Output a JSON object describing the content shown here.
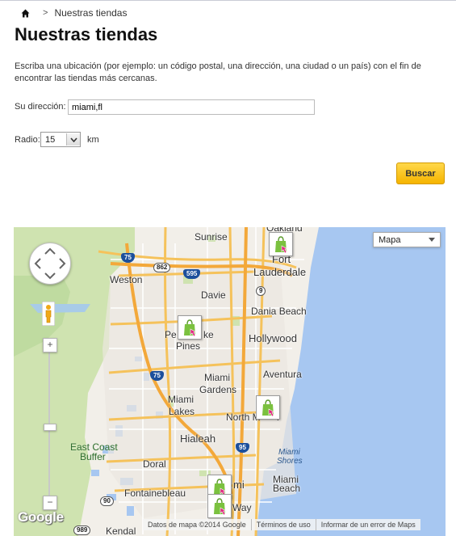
{
  "breadcrumb": {
    "separator": ">",
    "current": "Nuestras tiendas"
  },
  "page": {
    "title": "Nuestras tiendas",
    "intro": "Escriba una ubicación (por ejemplo: un código postal, una dirección, una ciudad o un país) con el fin de encontrar las tiendas más cercanas."
  },
  "form": {
    "address_label": "Su dirección:",
    "address_value": "miami,fl",
    "radius_label": "Radio:",
    "radius_value": "15",
    "radius_unit": "km",
    "search_button": "Buscar"
  },
  "map": {
    "type_selector": "Mapa",
    "zoom_in": "+",
    "zoom_out": "−",
    "logo": "Google",
    "footer": {
      "data": "Datos de mapa ©2014 Google",
      "terms": "Términos de uso",
      "report": "Informar de un error de Maps"
    },
    "places": {
      "oakland": "Oakland",
      "sunrise": "Sunrise",
      "fort": "Fort",
      "lauderdale": "Lauderdale",
      "weston": "Weston",
      "davie": "Davie",
      "dania_beach": "Dania Beach",
      "pembroke_a": "Pe",
      "pembroke_b": "ke",
      "pines": "Pines",
      "hollywood": "Hollywood",
      "aventura": "Aventura",
      "miami_gardens_a": "Miami",
      "miami_gardens_b": "Gardens",
      "miami_lakes_a": "Miami",
      "miami_lakes_b": "Lakes",
      "north_miami_a": "North M",
      "north_miami_b": "i",
      "east_coast_a": "East Coast",
      "east_coast_b": "Buffer",
      "hialeah": "Hialeah",
      "doral": "Doral",
      "miami_a": "Mi",
      "miami_b": "mi",
      "miami_beach_a": "Miami",
      "miami_beach_b": "Beach",
      "biscayne_a": "Miami",
      "biscayne_b": "Shores",
      "fontainebleau": "Fontainebleau",
      "kendall": "Kendal",
      "way": "Way"
    },
    "highways": {
      "i75_north": "75",
      "sr862": "862",
      "i595": "595",
      "sr9": "9",
      "i75_south": "75",
      "i95": "95",
      "sr90": "90",
      "sr989": "989"
    }
  }
}
